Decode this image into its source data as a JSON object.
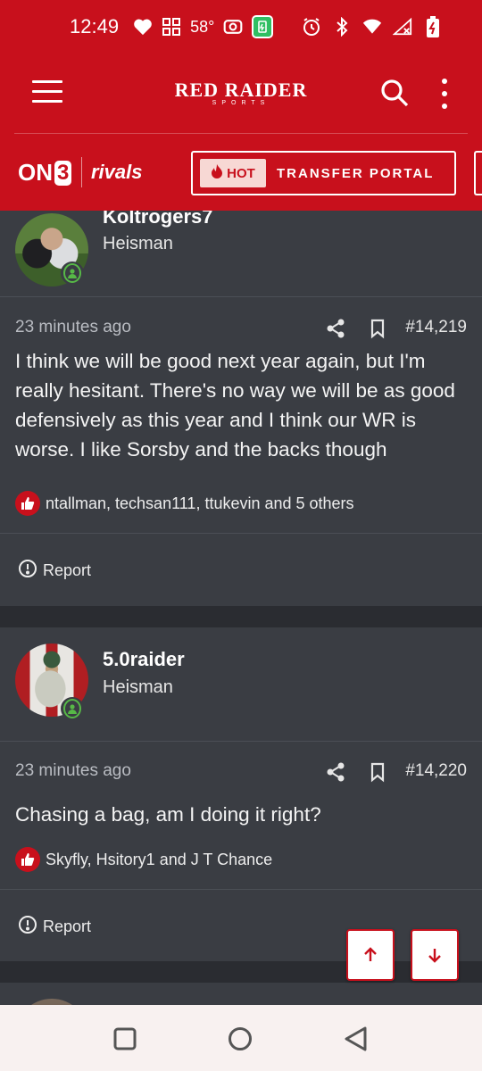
{
  "status_bar": {
    "time": "12:49",
    "temperature": "58°"
  },
  "app_bar": {
    "brand_name": "RED RAIDER",
    "brand_sub": "SPORTS"
  },
  "partner_bar": {
    "on3_prefix": "ON",
    "on3_suffix": "3",
    "rivals": "rivals",
    "hot_label": "HOT",
    "portal_label": "TRANSFER PORTAL"
  },
  "posts": [
    {
      "username": "Koltrogers7",
      "rank": "Heisman",
      "time": "23 minutes ago",
      "number": "#14,219",
      "body": "I think we will be good next year again, but I'm really hesitant. There's no way we will be as good defensively as this year and I think our WR is worse. I like Sorsby and the backs though",
      "reactions": "ntallman, techsan111, ttukevin and 5 others",
      "report": "Report"
    },
    {
      "username": "5.0raider",
      "rank": "Heisman",
      "time": "23 minutes ago",
      "number": "#14,220",
      "body": "Chasing a bag, am I doing it right?",
      "reactions": "Skyfly, Hsitory1 and J T Chance",
      "report": "Report"
    }
  ],
  "colors": {
    "brand_red": "#c8101c",
    "background": "#2f3237",
    "post_background": "#3a3d43",
    "online_green": "#57b947"
  }
}
